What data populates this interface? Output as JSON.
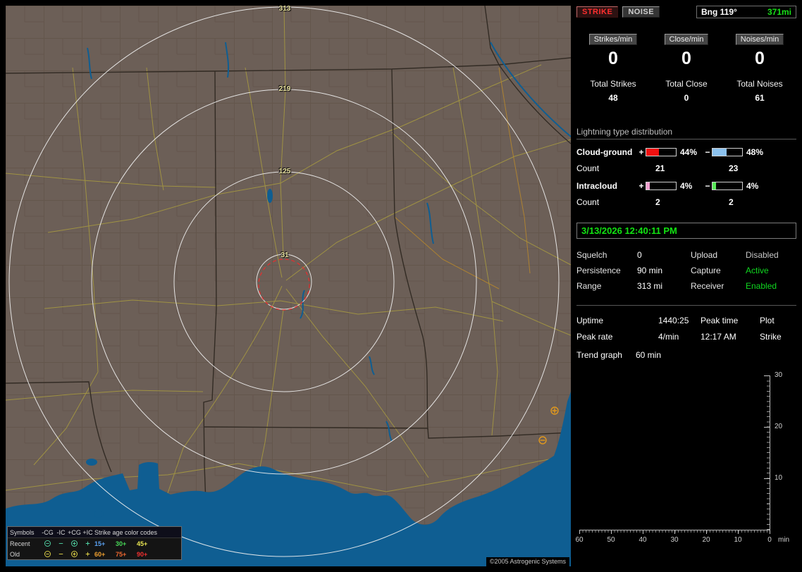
{
  "map": {
    "range_labels": [
      "313",
      "219",
      "125",
      "31"
    ],
    "copyright": "©2005 Astrogenic Systems",
    "legend": {
      "symbols_header": "Symbols",
      "columns": [
        "-CG",
        "-IC",
        "+CG",
        "+IC"
      ],
      "age_header": "Strike age color codes",
      "rows": [
        {
          "label": "Recent",
          "symbol_style": "color:#52d8a8",
          "ages": [
            {
              "text": "15+",
              "style": "color:#5aa0f0"
            },
            {
              "text": "30+",
              "style": "color:#48d858"
            },
            {
              "text": "45+",
              "style": "color:#e8e452"
            }
          ]
        },
        {
          "label": "Old",
          "symbol_style": "color:#e6d84a",
          "ages": [
            {
              "text": "60+",
              "style": "color:#f0a030"
            },
            {
              "text": "75+",
              "style": "color:#f06830"
            },
            {
              "text": "90+",
              "style": "color:#f03030"
            }
          ]
        }
      ]
    }
  },
  "panel": {
    "strike_button": "STRIKE",
    "noise_button": "NOISE",
    "bearing": "Bng 119°",
    "bearing_distance": "371mi",
    "rates": [
      {
        "label": "Strikes/min",
        "value": "0"
      },
      {
        "label": "Close/min",
        "value": "0"
      },
      {
        "label": "Noises/min",
        "value": "0"
      }
    ],
    "totals": [
      {
        "label": "Total Strikes",
        "value": "48"
      },
      {
        "label": "Total Close",
        "value": "0"
      },
      {
        "label": "Total Noises",
        "value": "61"
      }
    ],
    "distribution": {
      "title": "Lightning type distribution",
      "plus": "+",
      "minus": "−",
      "rows": [
        {
          "label": "Cloud-ground",
          "pos_pct": "44%",
          "pos_style": "width:44%;background:#f01010",
          "pos_color": "#f01010",
          "neg_pct": "48%",
          "neg_style": "width:48%;background:#8cc2ee",
          "neg_color": "#8cc2ee",
          "count_label": "Count",
          "pos_count": "21",
          "neg_count": "23"
        },
        {
          "label": "Intracloud",
          "pos_pct": "4%",
          "pos_style": "width:12%;background:#f0a0d0",
          "pos_color": "#f0a0d0",
          "neg_pct": "4%",
          "neg_style": "width:12%;background:#58e858",
          "neg_color": "#58e858",
          "count_label": "Count",
          "pos_count": "2",
          "neg_count": "2"
        }
      ]
    },
    "datetime": "3/13/2026 12:40:11 PM",
    "status": {
      "rows": [
        {
          "label1": "Squelch",
          "value1": "0",
          "label2": "Upload",
          "value2": "Disabled",
          "value2_style": "color:#c6c6c6"
        },
        {
          "label1": "Persistence",
          "value1": "90 min",
          "label2": "Capture",
          "value2": "Active",
          "value2_style": "color:#10d820"
        },
        {
          "label1": "Range",
          "value1": "313 mi",
          "label2": "Receiver",
          "value2": "Enabled",
          "value2_style": "color:#10d820"
        }
      ]
    },
    "info": {
      "rows": [
        {
          "c1": "Uptime",
          "c2": "1440:25",
          "c3": "Peak time",
          "c4": "Plot"
        },
        {
          "c1": "Peak rate",
          "c2": "4/min",
          "c3": "12:17 AM",
          "c4": "Strike"
        }
      ],
      "trend_label": "Trend graph",
      "trend_value": "60 min"
    },
    "graph": {
      "y_ticks": [
        "30",
        "20",
        "10"
      ],
      "x_ticks": [
        "60",
        "50",
        "40",
        "30",
        "20",
        "10",
        "0"
      ],
      "x_unit": "min"
    }
  },
  "colors": {
    "accent_green": "#12e412",
    "strike_red": "#ff2f2f",
    "map_land": "#6c5f57",
    "map_water": "#0f5e92",
    "range_ring": "#f2f2f2",
    "alarm_ring": "#e03030"
  }
}
